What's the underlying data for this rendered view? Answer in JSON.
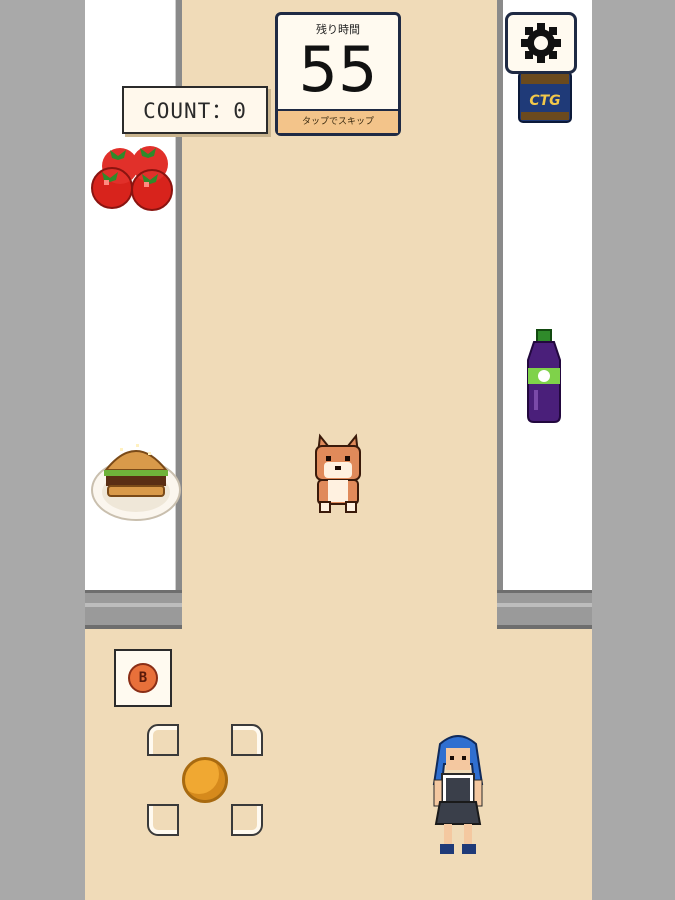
{
  "hud": {
    "count_text": "COUNT：0"
  },
  "timer": {
    "label": "残り時間",
    "value": "55",
    "hint": "タップでスキップ"
  },
  "controls": {
    "action_button_label": "B"
  },
  "icons": {
    "settings": "gear-icon",
    "joystick": "joystick-knob"
  },
  "items": {
    "can_label": "CTG"
  },
  "colors": {
    "floor": "#f0dbb8",
    "shelf": "#ffffff",
    "background": "#a9a9a9",
    "accent": "#f3c48a",
    "timer_border": "#1f2a44"
  }
}
